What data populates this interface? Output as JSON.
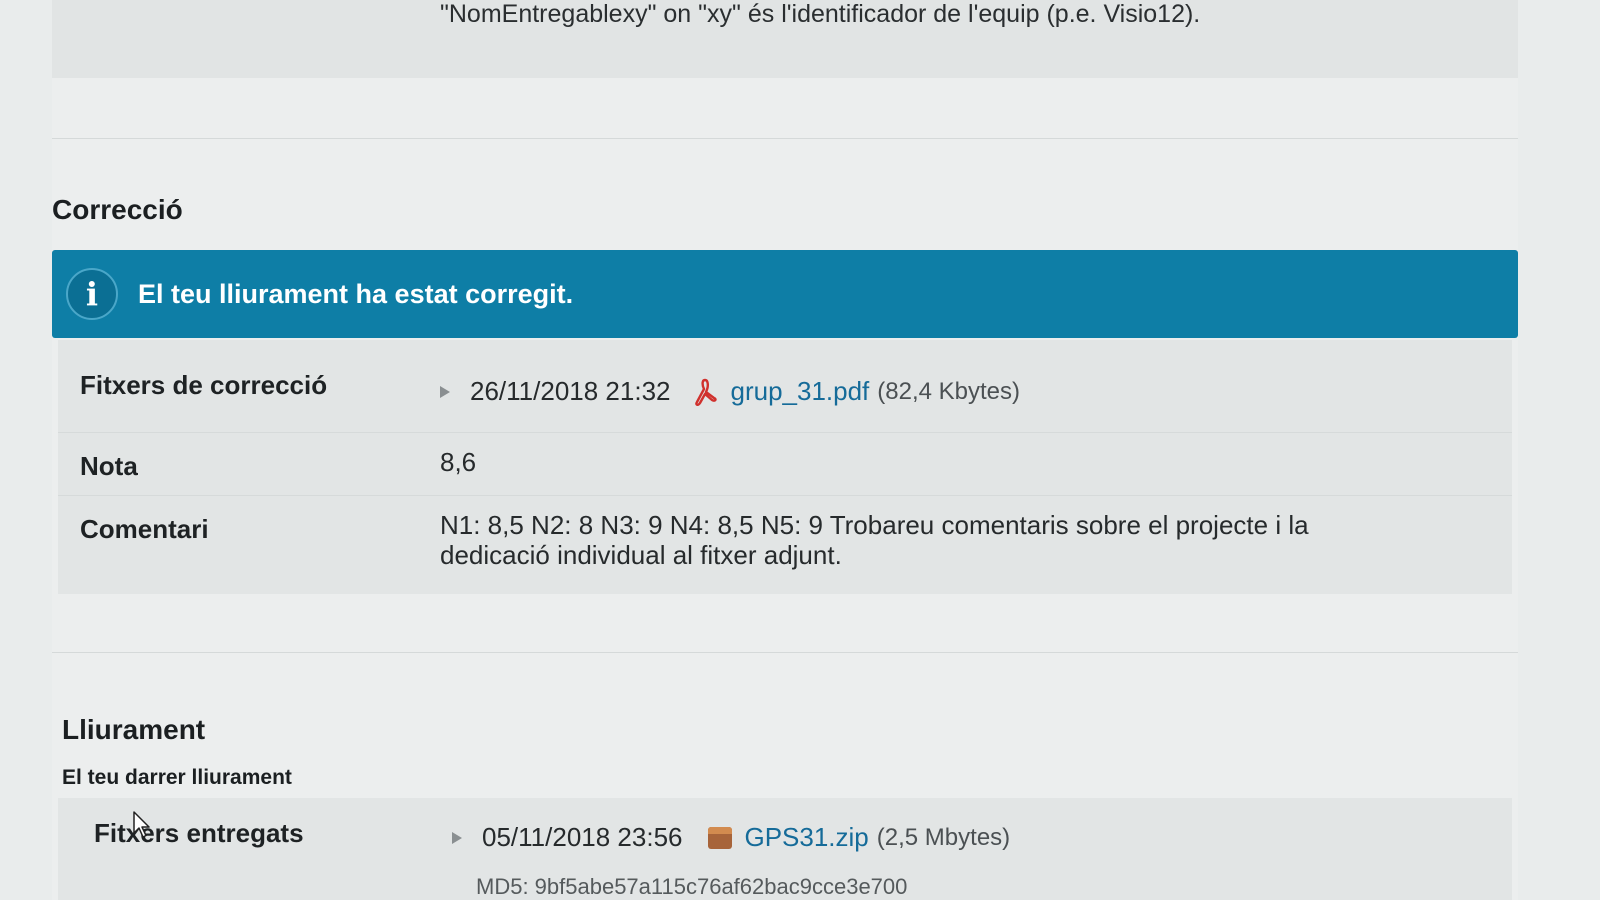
{
  "intro": {
    "text": "\"NomEntregablexy\" on \"xy\" és l'identificador de l'equip (p.e. Visio12)."
  },
  "correccio": {
    "title": "Correcció",
    "banner": {
      "icon": "info-icon",
      "icon_glyph": "i",
      "message": "El teu lliurament ha estat corregit.",
      "color": "#0e7ea6"
    },
    "rows": {
      "files": {
        "label": "Fitxers de correcció",
        "date": "26/11/2018 21:32",
        "file_icon": "pdf-icon",
        "file_name": "grup_31.pdf",
        "file_size": "(82,4 Kbytes)"
      },
      "grade": {
        "label": "Nota",
        "value": "8,6"
      },
      "comment": {
        "label": "Comentari",
        "value": "N1: 8,5 N2: 8 N3: 9 N4: 8,5 N5: 9 Trobareu comentaris sobre el projecte i la dedicació individual al fitxer adjunt."
      }
    }
  },
  "lliurament": {
    "title": "Lliurament",
    "subtitle": "El teu darrer lliurament",
    "rows": {
      "files": {
        "label": "Fitxers entregats",
        "date": "05/11/2018 23:56",
        "file_icon": "zip-icon",
        "file_name": "GPS31.zip",
        "file_size": "(2,5 Mbytes)",
        "md5": "MD5: 9bf5abe57a115c76af62bac9cce3e700"
      }
    }
  },
  "colors": {
    "link": "#156b99",
    "banner": "#0e7ea6"
  }
}
